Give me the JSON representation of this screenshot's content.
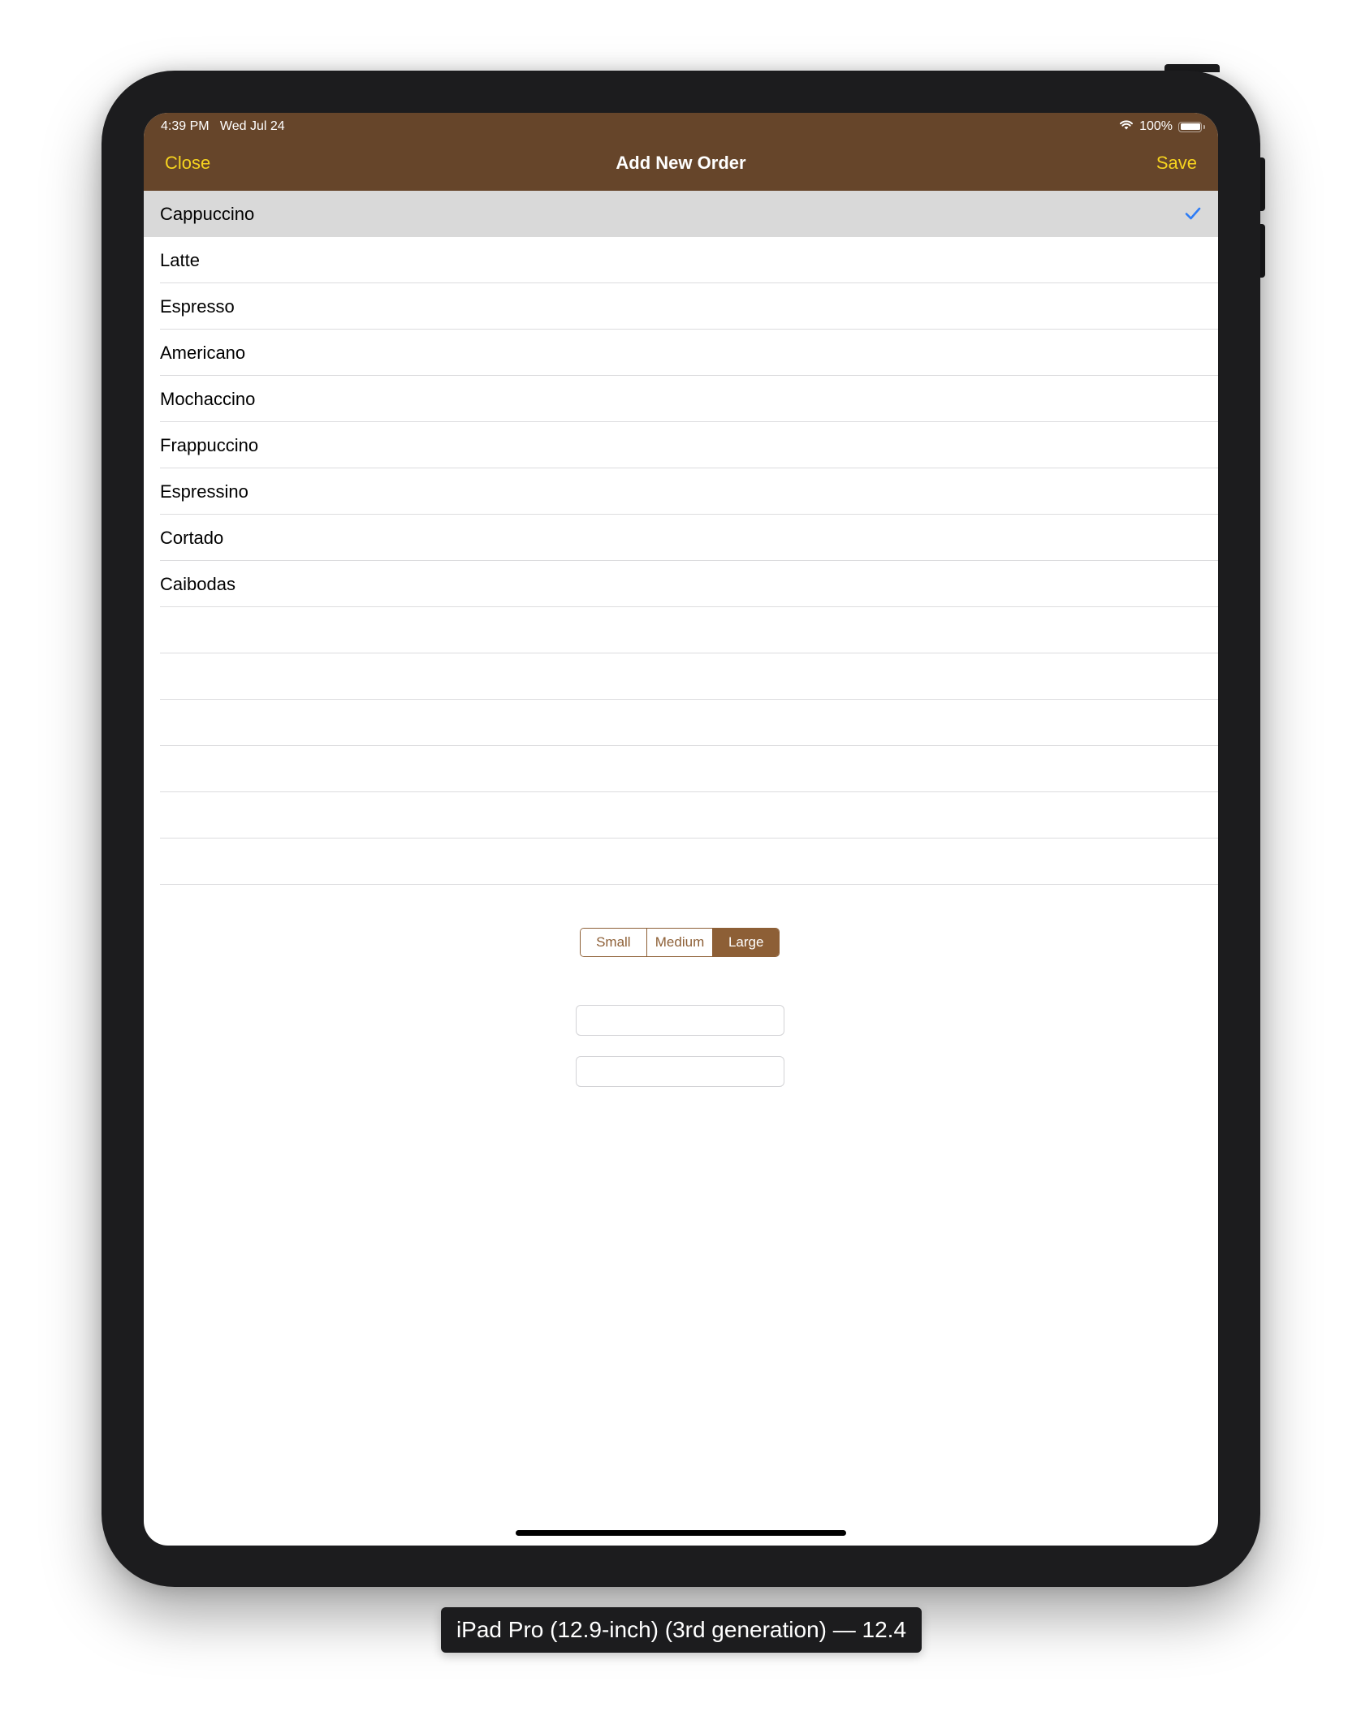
{
  "status_bar": {
    "time_date": "4:39 PM   Wed Jul 24",
    "battery_percent": "100%",
    "wifi_icon": "wifi-icon",
    "battery_icon": "battery-full-icon"
  },
  "nav": {
    "close_label": "Close",
    "title": "Add New Order",
    "save_label": "Save"
  },
  "colors": {
    "nav_background": "#66452a",
    "nav_button": "#f6d31f",
    "accent": "#8d5f36",
    "selected_row": "#d9d9d9",
    "checkmark": "#2d7cf6"
  },
  "coffee_list": {
    "selected_index": 0,
    "items": [
      {
        "label": "Cappuccino"
      },
      {
        "label": "Latte"
      },
      {
        "label": "Espresso"
      },
      {
        "label": "Americano"
      },
      {
        "label": "Mochaccino"
      },
      {
        "label": "Frappuccino"
      },
      {
        "label": "Espressino"
      },
      {
        "label": "Cortado"
      },
      {
        "label": "Caibodas"
      }
    ],
    "check_icon": "checkmark-icon"
  },
  "size_control": {
    "options": [
      "Small",
      "Medium",
      "Large"
    ],
    "selected": "Large"
  },
  "fields": {
    "field1_value": "",
    "field2_value": ""
  },
  "device_caption": "iPad Pro (12.9-inch) (3rd generation) — 12.4"
}
